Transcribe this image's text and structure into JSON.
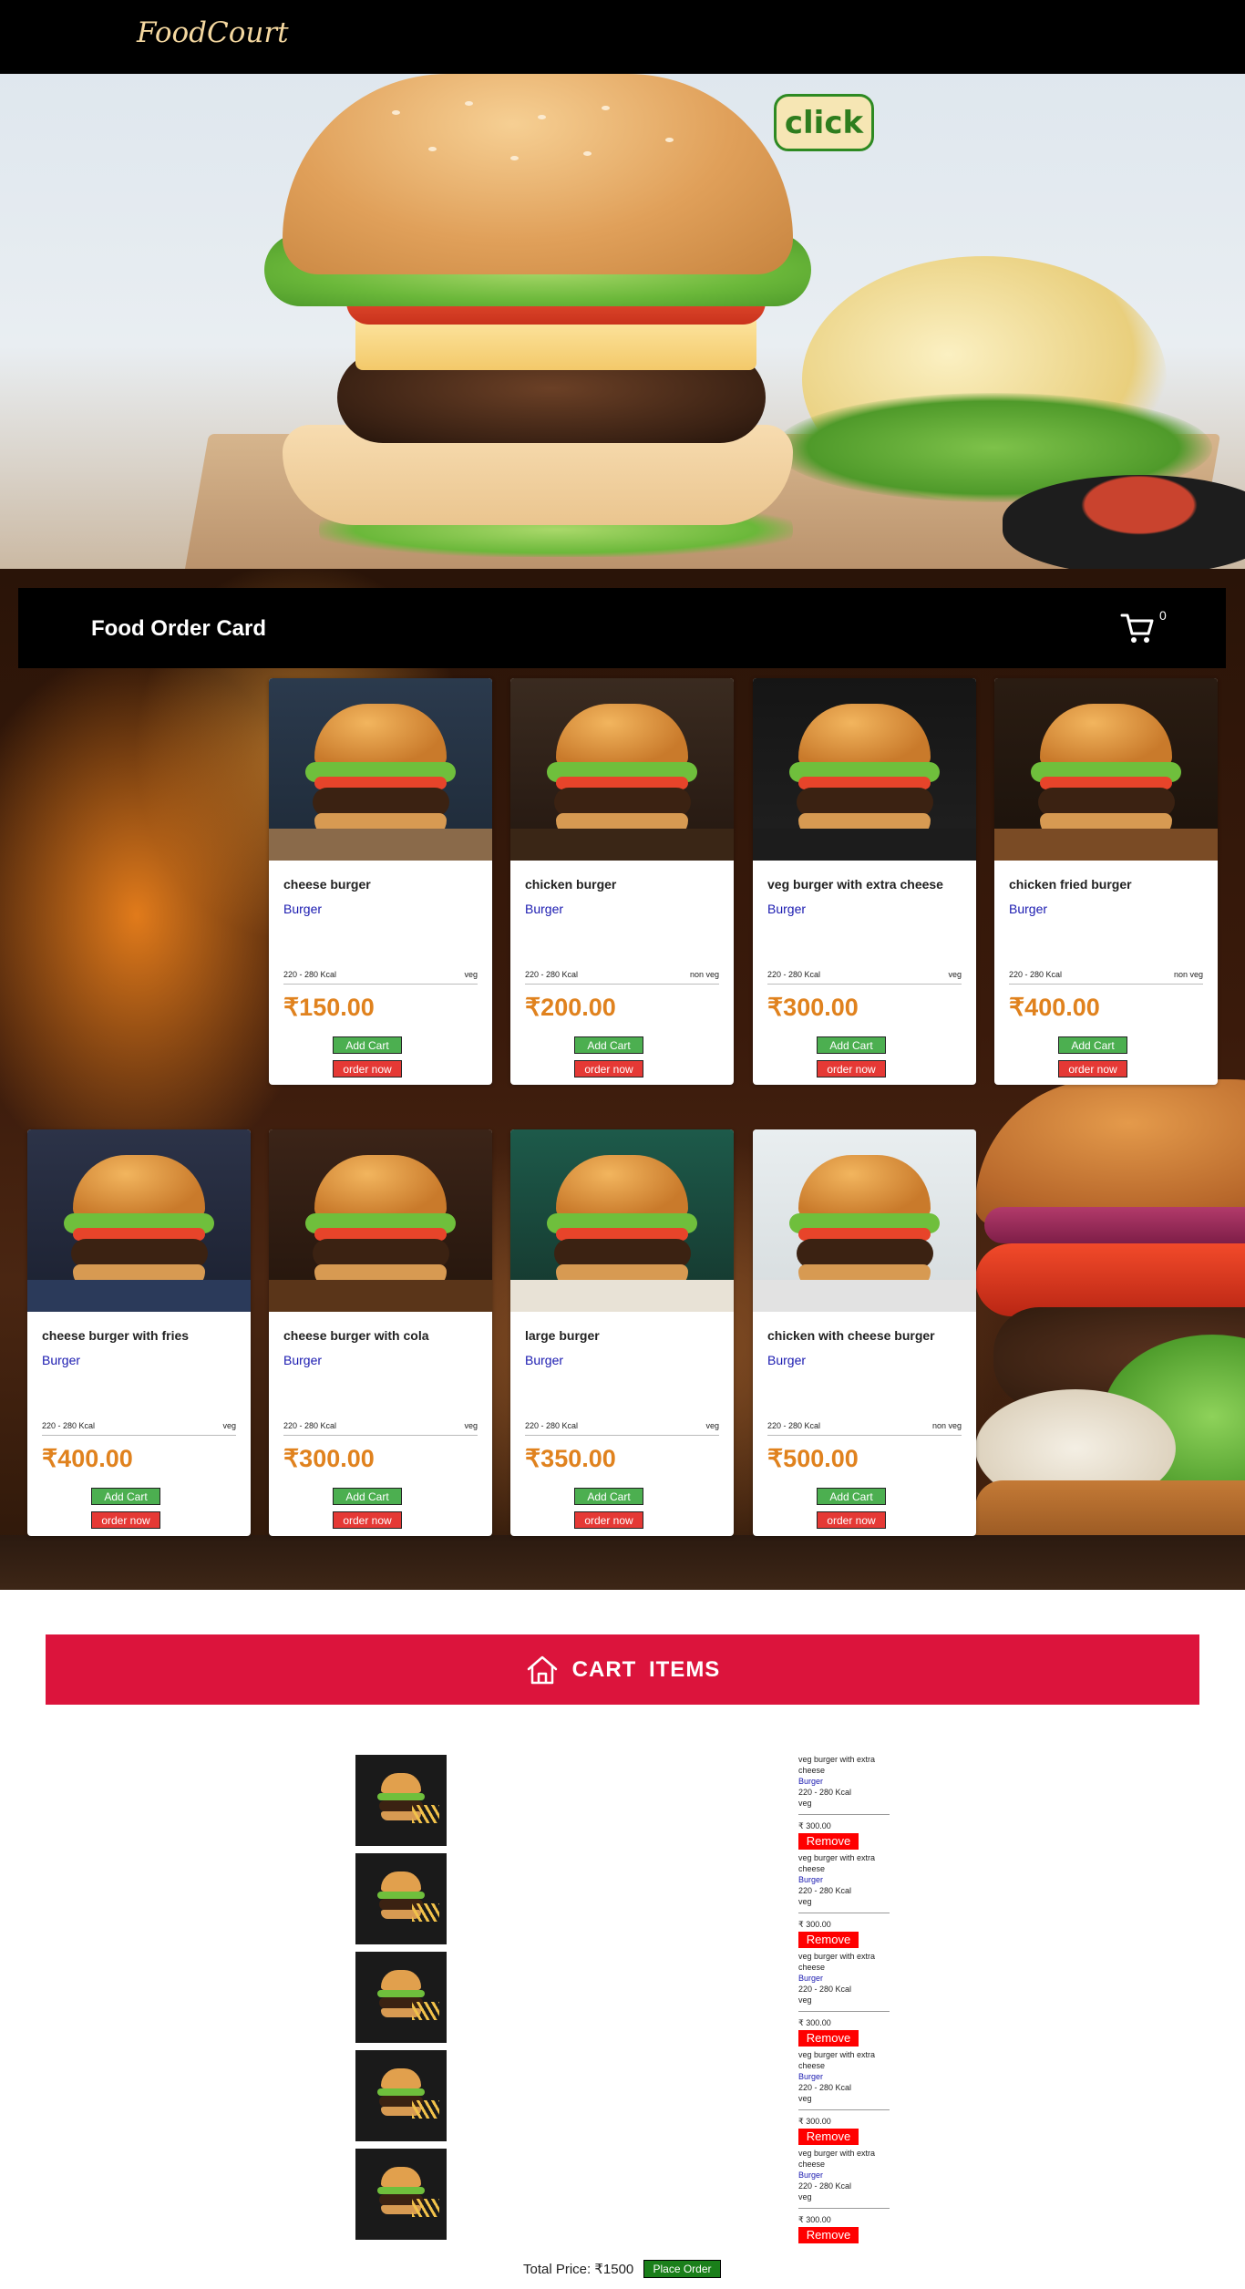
{
  "header": {
    "logo": "FoodCourt"
  },
  "hero": {
    "click_label": "click"
  },
  "order_bar": {
    "title": "Food Order Card",
    "cart_count": "0"
  },
  "cards": [
    {
      "name": "cheese burger",
      "category": "Burger",
      "kcal": "220 - 280 Kcal",
      "type": "veg",
      "price": "₹150.00",
      "add_label": "Add Cart",
      "order_label": "order now"
    },
    {
      "name": "chicken burger",
      "category": "Burger",
      "kcal": "220 - 280 Kcal",
      "type": "non veg",
      "price": "₹200.00",
      "add_label": "Add Cart",
      "order_label": "order now"
    },
    {
      "name": "veg burger with extra cheese",
      "category": "Burger",
      "kcal": "220 - 280 Kcal",
      "type": "veg",
      "price": "₹300.00",
      "add_label": "Add Cart",
      "order_label": "order now"
    },
    {
      "name": "chicken fried burger",
      "category": "Burger",
      "kcal": "220 - 280 Kcal",
      "type": "non veg",
      "price": "₹400.00",
      "add_label": "Add Cart",
      "order_label": "order now"
    },
    {
      "name": "cheese burger with fries",
      "category": "Burger",
      "kcal": "220 - 280 Kcal",
      "type": "veg",
      "price": "₹400.00",
      "add_label": "Add Cart",
      "order_label": "order now"
    },
    {
      "name": "cheese burger with cola",
      "category": "Burger",
      "kcal": "220 - 280 Kcal",
      "type": "veg",
      "price": "₹300.00",
      "add_label": "Add Cart",
      "order_label": "order now"
    },
    {
      "name": "large burger",
      "category": "Burger",
      "kcal": "220 - 280 Kcal",
      "type": "veg",
      "price": "₹350.00",
      "add_label": "Add Cart",
      "order_label": "order now"
    },
    {
      "name": "chicken with cheese burger",
      "category": "Burger",
      "kcal": "220 - 280 Kcal",
      "type": "non veg",
      "price": "₹500.00",
      "add_label": "Add Cart",
      "order_label": "order now"
    }
  ],
  "cart": {
    "title": "CART  ITEMS",
    "items": [
      {
        "name": "veg burger with extra cheese",
        "category": "Burger",
        "kcal": "220 - 280 Kcal",
        "type": "veg",
        "price": "₹ 300.00",
        "remove_label": "Remove"
      },
      {
        "name": "veg burger with extra cheese",
        "category": "Burger",
        "kcal": "220 - 280 Kcal",
        "type": "veg",
        "price": "₹ 300.00",
        "remove_label": "Remove"
      },
      {
        "name": "veg burger with extra cheese",
        "category": "Burger",
        "kcal": "220 - 280 Kcal",
        "type": "veg",
        "price": "₹ 300.00",
        "remove_label": "Remove"
      },
      {
        "name": "veg burger with extra cheese",
        "category": "Burger",
        "kcal": "220 - 280 Kcal",
        "type": "veg",
        "price": "₹ 300.00",
        "remove_label": "Remove"
      },
      {
        "name": "veg burger with extra cheese",
        "category": "Burger",
        "kcal": "220 - 280 Kcal",
        "type": "veg",
        "price": "₹ 300.00",
        "remove_label": "Remove"
      }
    ],
    "total_text": "Total Price: ₹1500",
    "place_order_label": "Place Order"
  },
  "colors": {
    "accent_red": "#dc143c",
    "price_orange": "#e0821e",
    "add_green": "#4caf50",
    "order_red": "#e53935",
    "category_blue": "#1a1ab0"
  },
  "icons": {
    "cart": "cart-icon",
    "home": "home-icon"
  }
}
